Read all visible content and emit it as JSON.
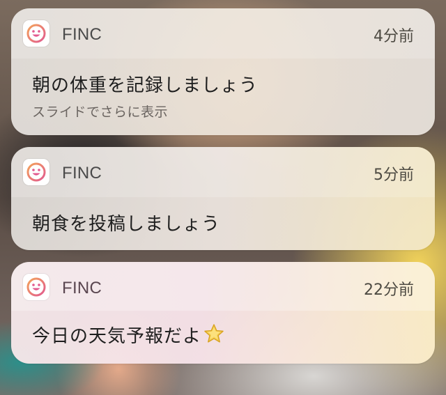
{
  "notifications": [
    {
      "app_name": "FINC",
      "time": "4分前",
      "message": "朝の体重を記録しましょう",
      "hint": "スライドでさらに表示",
      "icon": "finc-app-icon"
    },
    {
      "app_name": "FINC",
      "time": "5分前",
      "message": "朝食を投稿しましょう",
      "icon": "finc-app-icon"
    },
    {
      "app_name": "FINC",
      "time": "22分前",
      "message": "今日の天気予報だよ",
      "emoji": "star-icon",
      "icon": "finc-app-icon"
    }
  ],
  "colors": {
    "icon_ring": "#e86a8a",
    "icon_ring_inner": "#f3a35a",
    "star_fill": "#f7c948"
  }
}
